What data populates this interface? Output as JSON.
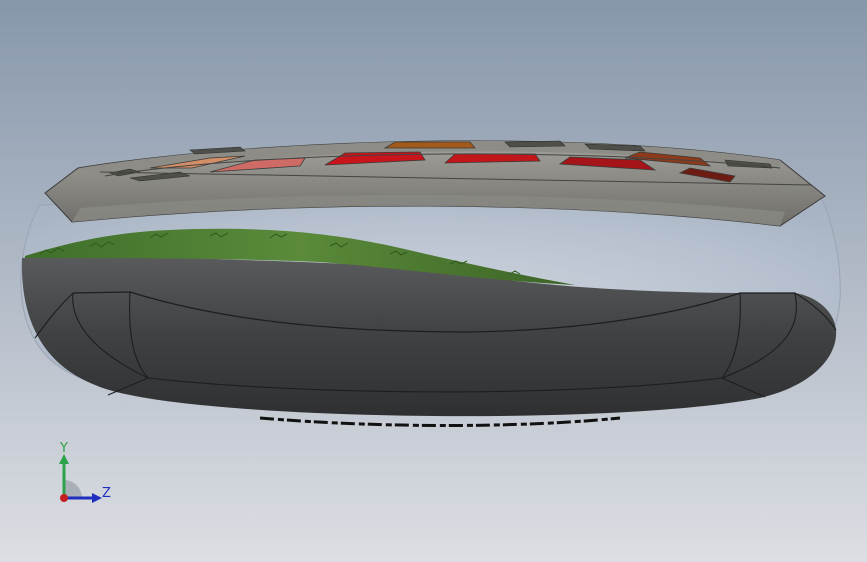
{
  "viewport": {
    "background_top": "#8797ab",
    "background_bottom": "#dcdee3"
  },
  "model": {
    "outer_rim_color": "#3e3f40",
    "rim_edge_color": "#5b5c5e",
    "top_frame_color": "#7b7a76",
    "top_frame_highlight": "#b4b3ad",
    "grass_color": "#4c7a32",
    "glass_color": "#c9d3e0",
    "stand_colors": [
      "#d28e67",
      "#cf6b66",
      "#c8141a",
      "#c2161b",
      "#a51419",
      "#8c3a1a",
      "#a55a1c",
      "#6d1c13"
    ]
  },
  "triad": {
    "y_label": "Y",
    "z_label": "Z",
    "y_color": "#2ca34a",
    "z_color": "#1e2fbf",
    "x_color": "#c51e1e"
  }
}
